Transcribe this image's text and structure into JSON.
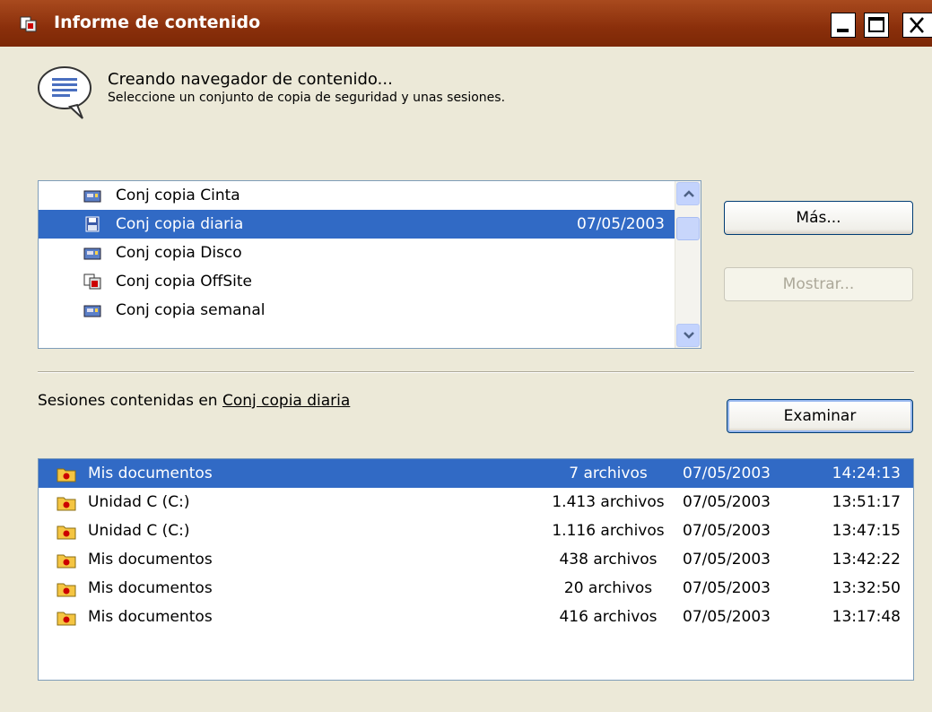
{
  "window": {
    "title": "Informe de contenido",
    "icon": "content-report-icon",
    "controls": [
      "minimize-icon",
      "maximize-icon",
      "close-icon"
    ]
  },
  "header": {
    "title": "Creando navegador de contenido...",
    "subtitle": "Seleccione un conjunto de copia de seguridad y unas sesiones.",
    "icon": "speech-bubble-icon"
  },
  "backup_sets": {
    "items": [
      {
        "label": "Conj copia Cinta",
        "date": "",
        "icon": "tape-drive-icon",
        "selected": false
      },
      {
        "label": "Conj copia diaria",
        "date": "07/05/2003",
        "icon": "floppy-disk-icon",
        "selected": true
      },
      {
        "label": "Conj copia Disco",
        "date": "",
        "icon": "tape-drive-icon",
        "selected": false
      },
      {
        "label": "Conj copia OffSite",
        "date": "",
        "icon": "offsite-icon",
        "selected": false
      },
      {
        "label": "Conj copia semanal",
        "date": "",
        "icon": "tape-drive-icon",
        "selected": false
      }
    ]
  },
  "buttons": {
    "more": "Más...",
    "show": "Mostrar...",
    "explore": "Examinar"
  },
  "sessions": {
    "label_prefix": "Sesiones contenidas en",
    "label_set": "Conj copia diaria",
    "rows": [
      {
        "name": "Mis documentos",
        "files": "7 archivos",
        "date": "07/05/2003",
        "time": "14:24:13",
        "selected": true
      },
      {
        "name": "Unidad C (C:)",
        "files": "1.413 archivos",
        "date": "07/05/2003",
        "time": "13:51:17",
        "selected": false
      },
      {
        "name": "Unidad C (C:)",
        "files": "1.116 archivos",
        "date": "07/05/2003",
        "time": "13:47:15",
        "selected": false
      },
      {
        "name": "Mis documentos",
        "files": "438 archivos",
        "date": "07/05/2003",
        "time": "13:42:22",
        "selected": false
      },
      {
        "name": "Mis documentos",
        "files": "20 archivos",
        "date": "07/05/2003",
        "time": "13:32:50",
        "selected": false
      },
      {
        "name": "Mis documentos",
        "files": "416 archivos",
        "date": "07/05/2003",
        "time": "13:17:48",
        "selected": false
      }
    ]
  },
  "colors": {
    "titlebar": "#8a2f0b",
    "selection": "#316ac5",
    "dialog_bg": "#ece9d8"
  }
}
